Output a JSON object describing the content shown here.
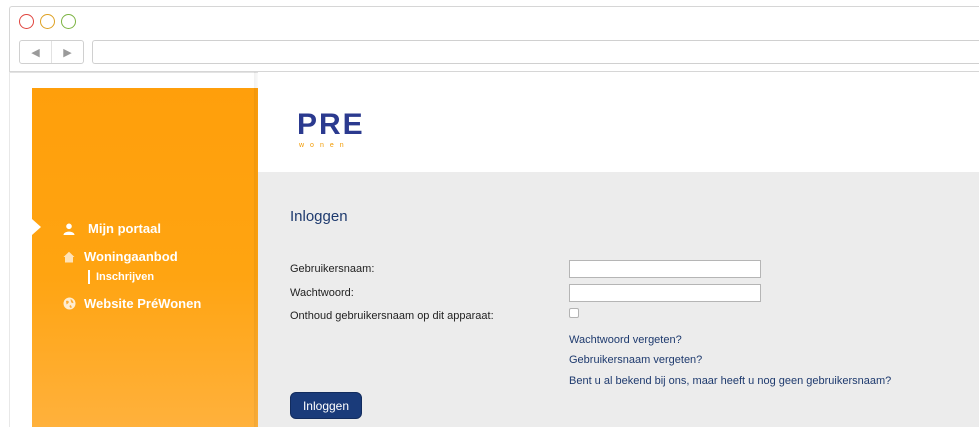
{
  "browser": {
    "nav_back": "◀",
    "nav_forward": "▶",
    "address": ""
  },
  "sidebar": {
    "items": [
      {
        "label": "Mijn portaal",
        "icon": "user-icon"
      },
      {
        "label": "Woningaanbod",
        "icon": "house-icon",
        "sub": [
          {
            "label": "Inschrijven"
          }
        ]
      },
      {
        "label": "Website PréWonen",
        "icon": "globe-icon"
      }
    ]
  },
  "logo": {
    "text": "PRE",
    "subtext": "wonen"
  },
  "login": {
    "title": "Inloggen",
    "username_label": "Gebruikersnaam:",
    "password_label": "Wachtwoord:",
    "remember_label": "Onthoud gebruikersnaam op dit apparaat:",
    "username_value": "",
    "password_value": "",
    "links": [
      "Wachtwoord vergeten?",
      "Gebruikersnaam vergeten?",
      "Bent u al bekend bij ons, maar heeft u nog geen gebruikersnaam?"
    ],
    "button": "Inloggen"
  },
  "colors": {
    "accent_orange": "#ff9f0b",
    "brand_blue": "#2b3a8f",
    "button_blue": "#1a3b7a",
    "content_gray": "#ececec"
  }
}
